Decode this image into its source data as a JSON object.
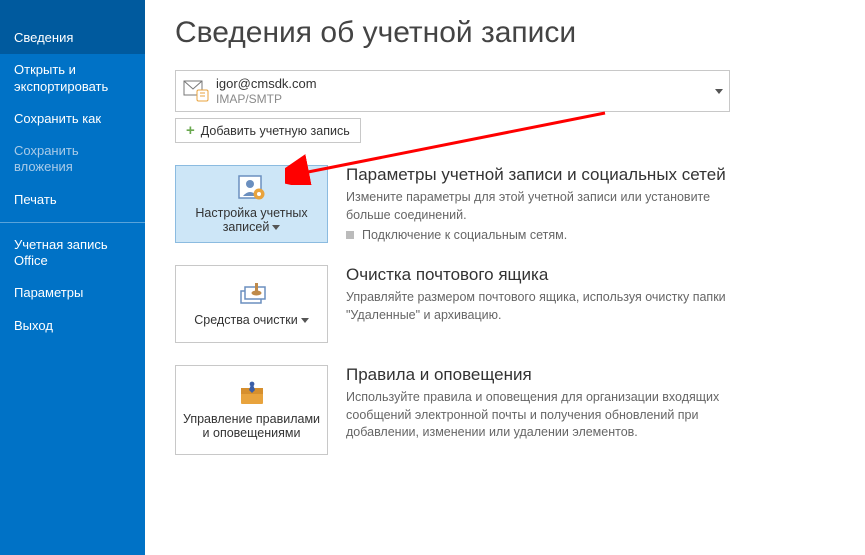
{
  "sidebar": {
    "items": [
      {
        "label": "Сведения",
        "state": "selected"
      },
      {
        "label": "Открыть и экспортировать",
        "state": ""
      },
      {
        "label": "Сохранить как",
        "state": ""
      },
      {
        "label": "Сохранить вложения",
        "state": "disabled"
      },
      {
        "label": "Печать",
        "state": ""
      },
      {
        "label": "Учетная запись Office",
        "state": ""
      },
      {
        "label": "Параметры",
        "state": ""
      },
      {
        "label": "Выход",
        "state": ""
      }
    ]
  },
  "page": {
    "title": "Сведения об учетной записи"
  },
  "account": {
    "email": "igor@cmsdk.com",
    "protocol": "IMAP/SMTP",
    "add_label": "Добавить учетную запись"
  },
  "sections": {
    "settings": {
      "tile_label": "Настройка учетных записей",
      "title": "Параметры учетной записи и социальных сетей",
      "desc": "Измените параметры для этой учетной записи или установите больше соединений.",
      "bullet": "Подключение к социальным сетям."
    },
    "cleanup": {
      "tile_label": "Средства очистки",
      "title": "Очистка почтового ящика",
      "desc": "Управляйте размером почтового ящика, используя очистку папки \"Удаленные\" и архивацию."
    },
    "rules": {
      "tile_label": "Управление правилами и оповещениями",
      "title": "Правила и оповещения",
      "desc": "Используйте правила и оповещения для организации входящих сообщений электронной почты и получения обновлений при добавлении, изменении или удалении элементов."
    }
  }
}
